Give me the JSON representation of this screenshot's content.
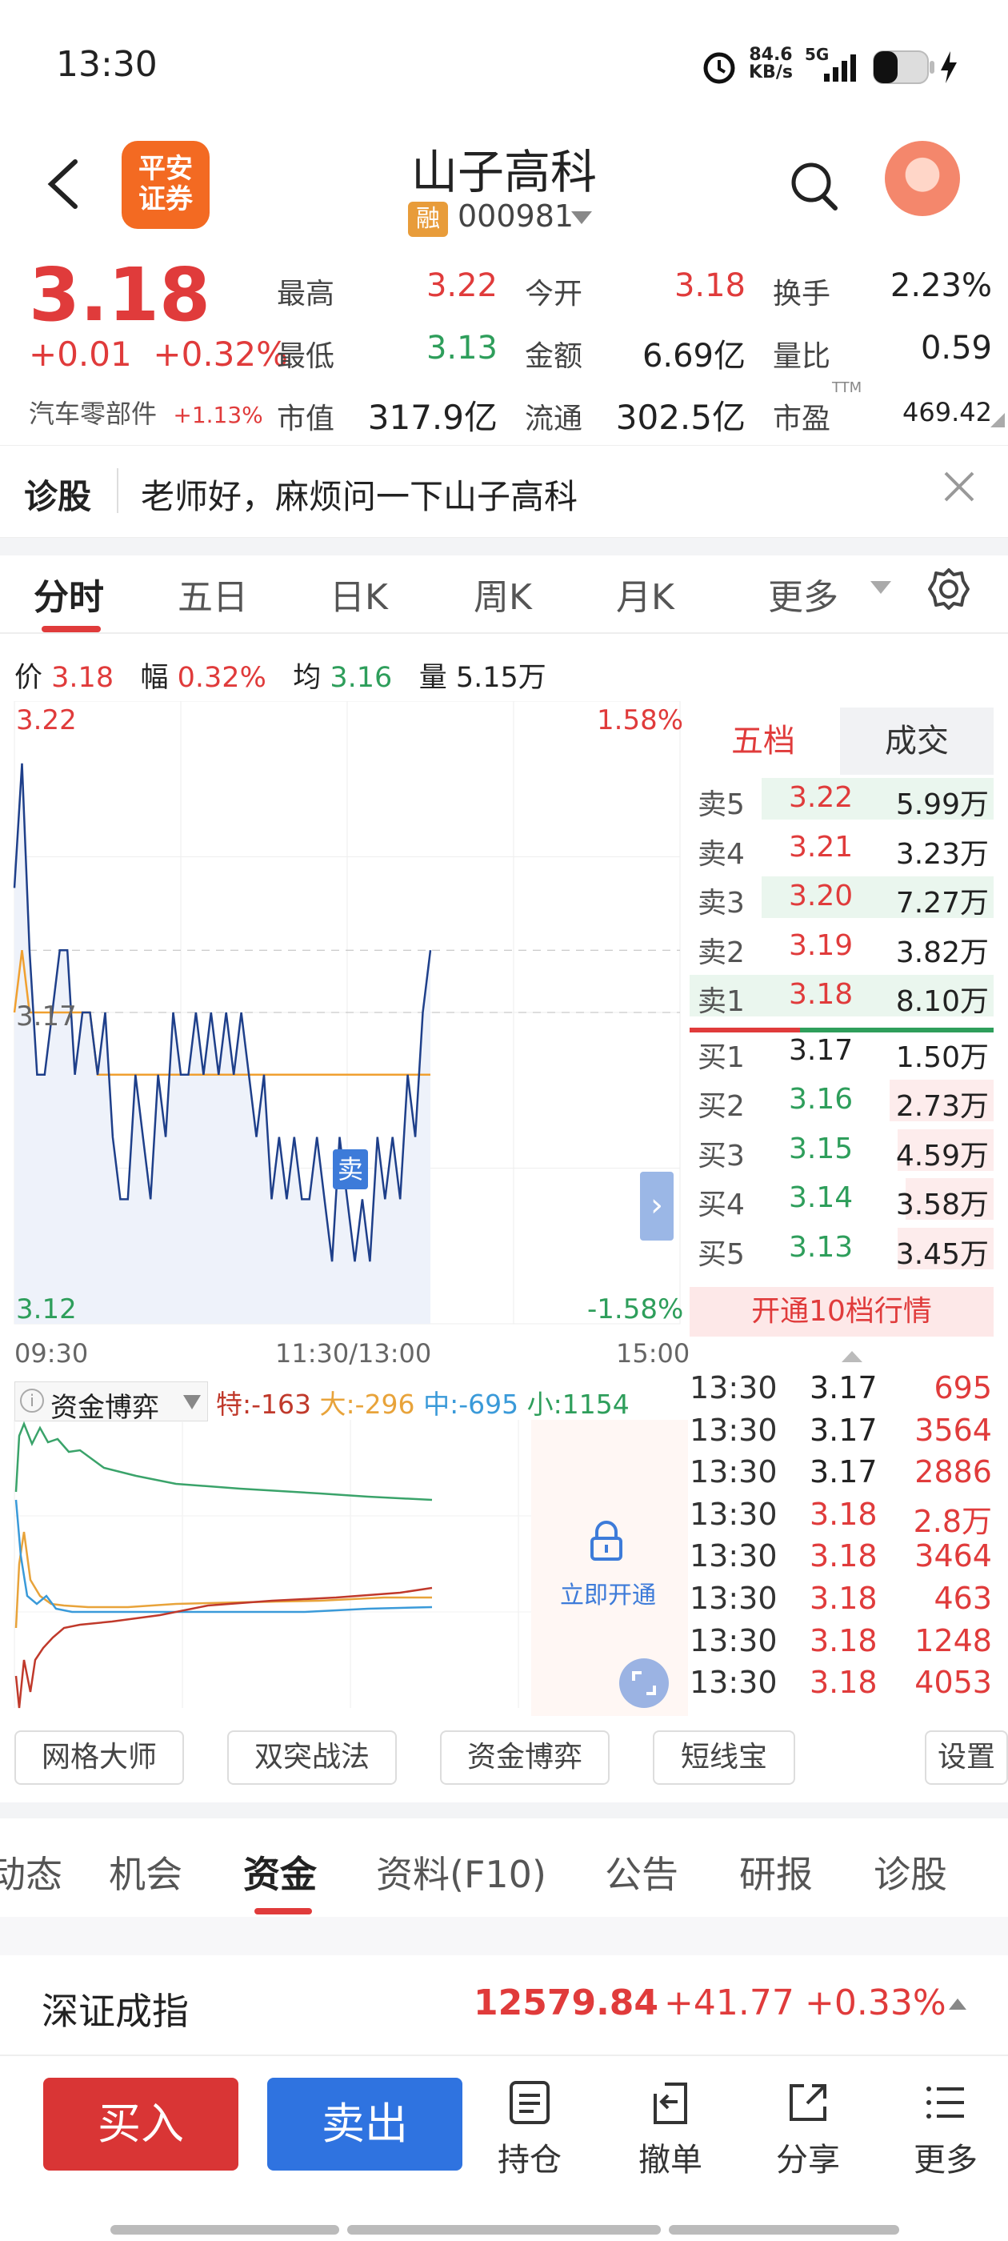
{
  "status_bar": {
    "time": "13:30",
    "net_speed": "84.6",
    "net_unit": "KB/s",
    "signal": "5G"
  },
  "header": {
    "title": "山子高科",
    "code": "000981",
    "rong_badge": "融",
    "logo_text_1": "平安",
    "logo_text_2": "证券"
  },
  "quote": {
    "price": "3.18",
    "change": "+0.01",
    "change_pct": "+0.32%",
    "sector": "汽车零部件",
    "sector_pct": "+1.13%",
    "high_label": "最高",
    "high": "3.22",
    "open_label": "今开",
    "open": "3.18",
    "turnover_label": "换手",
    "turnover": "2.23%",
    "low_label": "最低",
    "low": "3.13",
    "amount_label": "金额",
    "amount": "6.69亿",
    "vol_ratio_label": "量比",
    "vol_ratio": "0.59",
    "mktcap_label": "市值",
    "mktcap": "317.9亿",
    "float_label": "流通",
    "float": "302.5亿",
    "pe_label": "市盈",
    "pe_sup": "TTM",
    "pe": "469.42"
  },
  "banner": {
    "label": "诊股",
    "text": "老师好，麻烦问一下山子高科"
  },
  "chart_tabs": [
    "分时",
    "五日",
    "日K",
    "周K",
    "月K",
    "更多"
  ],
  "chart_info": {
    "price_label": "价",
    "price": "3.18",
    "amp_label": "幅",
    "amp": "0.32%",
    "avg_label": "均",
    "avg": "3.16",
    "vol_label": "量",
    "vol": "5.15万"
  },
  "chart_data": {
    "type": "line",
    "y_top": "3.22",
    "y_mid": "3.17",
    "y_bottom": "3.12",
    "pct_top": "1.58%",
    "pct_bottom": "-1.58%",
    "x_ticks": [
      "09:30",
      "11:30/13:00",
      "15:00"
    ],
    "ylim": [
      3.12,
      3.22
    ],
    "series": [
      {
        "values": [
          3.19,
          3.21,
          3.18,
          3.16,
          3.16,
          3.17,
          3.18,
          3.18,
          3.16,
          3.17,
          3.17,
          3.16,
          3.17,
          3.15,
          3.14,
          3.14,
          3.16,
          3.15,
          3.14,
          3.16,
          3.15,
          3.17,
          3.16,
          3.16,
          3.17,
          3.16,
          3.17,
          3.16,
          3.17,
          3.16,
          3.17,
          3.16,
          3.15,
          3.16,
          3.14,
          3.15,
          3.14,
          3.15,
          3.14,
          3.14,
          3.15,
          3.14,
          3.13,
          3.15,
          3.14,
          3.13,
          3.14,
          3.13,
          3.15,
          3.14,
          3.15,
          3.14,
          3.16,
          3.15,
          3.17,
          3.18
        ]
      },
      {
        "values": [
          3.17,
          3.18,
          3.17,
          3.17,
          3.17,
          3.17,
          3.17,
          3.17,
          3.17,
          3.17,
          3.17,
          3.16,
          3.16,
          3.16,
          3.16,
          3.16,
          3.16,
          3.16,
          3.16,
          3.16,
          3.16,
          3.16,
          3.16,
          3.16,
          3.16,
          3.16,
          3.16,
          3.16,
          3.16,
          3.16,
          3.16,
          3.16,
          3.16,
          3.16,
          3.16,
          3.16,
          3.16,
          3.16,
          3.16,
          3.16,
          3.16,
          3.16,
          3.16,
          3.16,
          3.16,
          3.16,
          3.16,
          3.16,
          3.16,
          3.16,
          3.16,
          3.16,
          3.16,
          3.16,
          3.16,
          3.16
        ]
      }
    ],
    "marker": "卖"
  },
  "orderbook": {
    "tabs": [
      "五档",
      "成交"
    ],
    "rows": [
      {
        "label": "卖5",
        "price": "3.22",
        "vol": "5.99万",
        "pc": "red"
      },
      {
        "label": "卖4",
        "price": "3.21",
        "vol": "3.23万",
        "pc": "red"
      },
      {
        "label": "卖3",
        "price": "3.20",
        "vol": "7.27万",
        "pc": "red"
      },
      {
        "label": "卖2",
        "price": "3.19",
        "vol": "3.82万",
        "pc": "red"
      },
      {
        "label": "卖1",
        "price": "3.18",
        "vol": "8.10万",
        "pc": "red"
      },
      {
        "label": "买1",
        "price": "3.17",
        "vol": "1.50万",
        "pc": "black"
      },
      {
        "label": "买2",
        "price": "3.16",
        "vol": "2.73万",
        "pc": "green"
      },
      {
        "label": "买3",
        "price": "3.15",
        "vol": "4.59万",
        "pc": "green"
      },
      {
        "label": "买4",
        "price": "3.14",
        "vol": "3.58万",
        "pc": "green"
      },
      {
        "label": "买5",
        "price": "3.13",
        "vol": "3.45万",
        "pc": "green"
      }
    ],
    "open10": "开通10档行情"
  },
  "capital": {
    "title": "资金博弈",
    "te_label": "特:",
    "te": "-163",
    "da_label": "大:",
    "da": "-296",
    "zhong_label": "中:",
    "zhong": "-695",
    "xiao_label": "小:",
    "xiao": "1154",
    "unlock": "立即开通"
  },
  "trades": [
    {
      "time": "13:30",
      "price": "3.17",
      "vol": "695",
      "pc": "black"
    },
    {
      "time": "13:30",
      "price": "3.17",
      "vol": "3564",
      "pc": "black"
    },
    {
      "time": "13:30",
      "price": "3.17",
      "vol": "2886",
      "pc": "black"
    },
    {
      "time": "13:30",
      "price": "3.18",
      "vol": "2.8万",
      "pc": "red"
    },
    {
      "time": "13:30",
      "price": "3.18",
      "vol": "3464",
      "pc": "red"
    },
    {
      "time": "13:30",
      "price": "3.18",
      "vol": "463",
      "pc": "red"
    },
    {
      "time": "13:30",
      "price": "3.18",
      "vol": "1248",
      "pc": "red"
    },
    {
      "time": "13:30",
      "price": "3.18",
      "vol": "4053",
      "pc": "red"
    }
  ],
  "tools": [
    "网格大师",
    "双突战法",
    "资金博弈",
    "短线宝",
    "设置"
  ],
  "news_tabs": [
    "动态",
    "机会",
    "资金",
    "资料(F10)",
    "公告",
    "研报",
    "诊股"
  ],
  "index": {
    "name": "深证成指",
    "value": "12579.84",
    "change": "+41.77",
    "pct": "+0.33%"
  },
  "bottom": {
    "buy": "买入",
    "sell": "卖出",
    "hold": "持仓",
    "cancel": "撤单",
    "share": "分享",
    "more": "更多"
  }
}
